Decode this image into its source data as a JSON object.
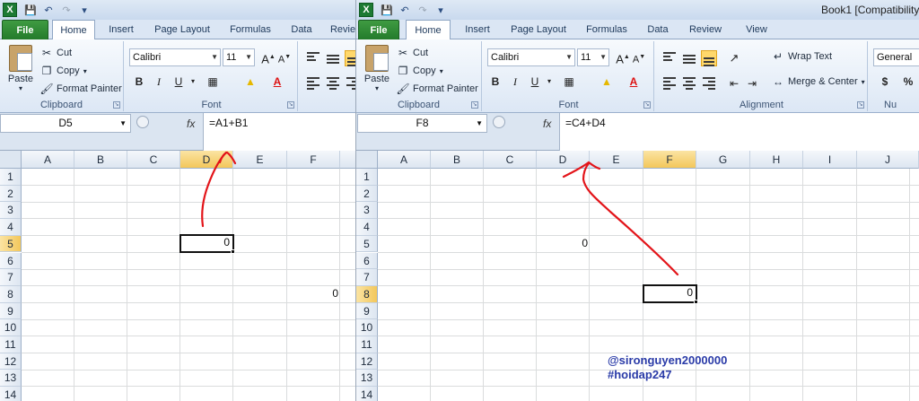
{
  "left": {
    "title_icons": {
      "logo": "X",
      "save": "save-icon",
      "undo": "undo-icon",
      "redo": "redo-icon"
    },
    "tabs": [
      "File",
      "Home",
      "Insert",
      "Page Layout",
      "Formulas",
      "Data",
      "Revie"
    ],
    "clipboard": {
      "paste": "Paste",
      "cut": "Cut",
      "copy": "Copy",
      "format_painter": "Format Painter",
      "label": "Clipboard"
    },
    "font": {
      "name": "Calibri",
      "size": "11",
      "label": "Font",
      "bold": "B",
      "italic": "I",
      "underline": "U"
    },
    "name_box": "D5",
    "fx": "fx",
    "formula": "=A1+B1",
    "columns": [
      "A",
      "B",
      "C",
      "D",
      "E",
      "F"
    ],
    "rows": [
      "1",
      "2",
      "3",
      "4",
      "5",
      "6",
      "7",
      "8",
      "9",
      "10",
      "11",
      "12",
      "13",
      "14"
    ],
    "active_cell_value": "0",
    "other_value": "0"
  },
  "right": {
    "tabs": [
      "File",
      "Home",
      "Insert",
      "Page Layout",
      "Formulas",
      "Data",
      "Review",
      "View"
    ],
    "title": "Book1  [Compatibility",
    "clipboard": {
      "paste": "Paste",
      "cut": "Cut",
      "copy": "Copy",
      "format_painter": "Format Painter",
      "label": "Clipboard"
    },
    "font": {
      "name": "Calibri",
      "size": "11",
      "label": "Font",
      "bold": "B",
      "italic": "I",
      "underline": "U"
    },
    "alignment": {
      "wrap_text": "Wrap Text",
      "merge_center": "Merge & Center",
      "label": "Alignment"
    },
    "number": {
      "format": "General",
      "label": "Nu",
      "currency": "$",
      "percent": "%"
    },
    "name_box": "F8",
    "fx": "fx",
    "formula": "=C4+D4",
    "columns": [
      "A",
      "B",
      "C",
      "D",
      "E",
      "F",
      "G",
      "H",
      "I",
      "J"
    ],
    "rows": [
      "1",
      "2",
      "3",
      "4",
      "5",
      "6",
      "7",
      "8",
      "9",
      "10",
      "11",
      "12",
      "13",
      "14"
    ],
    "d5_value": "0",
    "active_cell_value": "0"
  },
  "watermark": {
    "line1": "@sironguyen2000000",
    "line2": "#hoidap247"
  },
  "colors": {
    "annotation": "#e3151a",
    "watermark": "#2a3ba8",
    "file_tab": "#2f8c36",
    "selected_header": "#f3c75b"
  }
}
